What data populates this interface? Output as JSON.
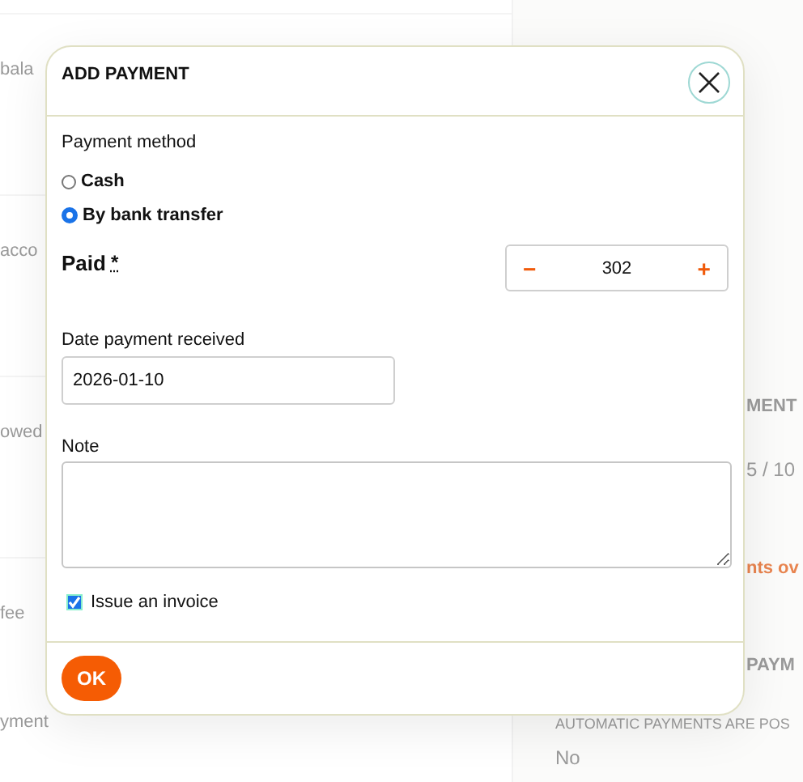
{
  "background": {
    "left_rows": [
      "bala",
      "acco",
      "owed",
      "fee",
      "yment"
    ],
    "right_items": [
      {
        "kind": "heading",
        "text": "MENT"
      },
      {
        "kind": "text",
        "text": "5 / 10"
      },
      {
        "kind": "link",
        "text": "nts ov"
      },
      {
        "kind": "heading",
        "text": "PAYM"
      },
      {
        "kind": "caption",
        "text": "AUTOMATIC PAYMENTS ARE POS"
      },
      {
        "kind": "text",
        "text": "No"
      }
    ]
  },
  "dialog": {
    "title": "ADD PAYMENT",
    "payment_method": {
      "label": "Payment method",
      "options": [
        {
          "label": "Cash",
          "selected": false
        },
        {
          "label": "By bank transfer",
          "selected": true
        }
      ]
    },
    "paid": {
      "label": "Paid",
      "required_mark": "*",
      "decrement": "−",
      "value": "302",
      "increment": "+"
    },
    "date": {
      "label": "Date payment received",
      "value": "2026-01-10"
    },
    "note": {
      "label": "Note"
    },
    "invoice": {
      "label": "Issue an invoice",
      "checked": true
    },
    "ok_button": "OK"
  }
}
